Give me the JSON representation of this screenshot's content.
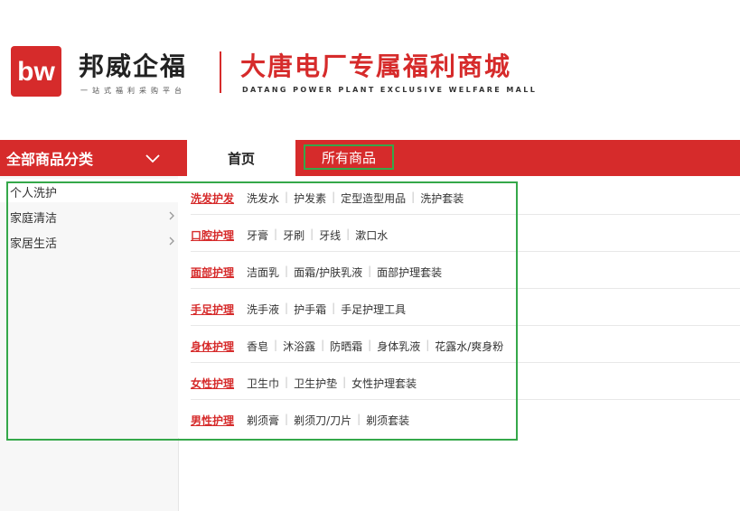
{
  "header": {
    "brand_name": "邦威企福",
    "brand_tagline": "一站式福利采购平台",
    "mall_title": "大唐电厂专属福利商城",
    "mall_subtitle": "DATANG POWER PLANT EXCLUSIVE WELFARE MALL",
    "logo_icon": "bw-logo",
    "accent_color": "#d62b2b"
  },
  "nav": {
    "all_categories": "全部商品分类",
    "home": "首页",
    "all_products": "所有商品"
  },
  "sidebar": {
    "items": [
      {
        "label": "个人洗护",
        "active": true
      },
      {
        "label": "家庭清洁",
        "icon": "chevron-right-icon"
      },
      {
        "label": "家居生活",
        "icon": "chevron-right-icon"
      }
    ]
  },
  "dropdown": {
    "rows": [
      {
        "category": "洗发护发",
        "subs": [
          "洗发水",
          "护发素",
          "定型造型用品",
          "洗护套装"
        ]
      },
      {
        "category": "口腔护理",
        "subs": [
          "牙膏",
          "牙刷",
          "牙线",
          "漱口水"
        ]
      },
      {
        "category": "面部护理",
        "subs": [
          "洁面乳",
          "面霜/护肤乳液",
          "面部护理套装"
        ]
      },
      {
        "category": "手足护理",
        "subs": [
          "洗手液",
          "护手霜",
          "手足护理工具"
        ]
      },
      {
        "category": "身体护理",
        "subs": [
          "香皂",
          "沐浴露",
          "防晒霜",
          "身体乳液",
          "花露水/爽身粉"
        ]
      },
      {
        "category": "女性护理",
        "subs": [
          "卫生巾",
          "卫生护垫",
          "女性护理套装"
        ]
      },
      {
        "category": "男性护理",
        "subs": [
          "剃须膏",
          "剃须刀/刀片",
          "剃须套装"
        ]
      }
    ]
  },
  "highlight_color": "#35a84a"
}
